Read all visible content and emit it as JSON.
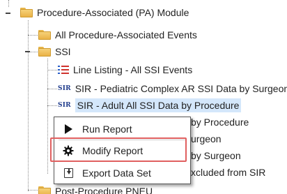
{
  "tree": {
    "module": {
      "label": "Procedure-Associated (PA) Module",
      "icon": "folder-icon"
    },
    "all_events": {
      "label": "All Procedure-Associated Events",
      "icon": "folder-icon"
    },
    "ssi": {
      "label": "SSI",
      "icon": "folder-icon"
    },
    "items": [
      {
        "label": "Line Listing - All SSI Events",
        "icon": "line-listing-icon"
      },
      {
        "label": "SIR - Pediatric Complex AR SSI Data by Surgeon",
        "icon": "sir-icon",
        "icon_text": "SIR"
      },
      {
        "label": "SIR - Adult All SSI Data by Procedure",
        "icon": "sir-icon",
        "icon_text": "SIR",
        "selected": true
      },
      {
        "label": "by Procedure"
      },
      {
        "label": "urgeon"
      },
      {
        "label": "by Surgeon"
      },
      {
        "label": "xcluded from SIR"
      }
    ],
    "post_procedure": {
      "label": "Post-Procedure PNEU",
      "icon": "folder-icon"
    }
  },
  "context_menu": {
    "items": [
      {
        "label": "Run Report",
        "icon": "play-icon"
      },
      {
        "label": "Modify Report",
        "icon": "gear-icon",
        "highlighted": true
      },
      {
        "label": "Export Data Set",
        "icon": "export-icon"
      }
    ]
  },
  "colors": {
    "selection": "#d4e7fb",
    "highlight_border": "#e05f5f",
    "folder": "#eab247"
  }
}
